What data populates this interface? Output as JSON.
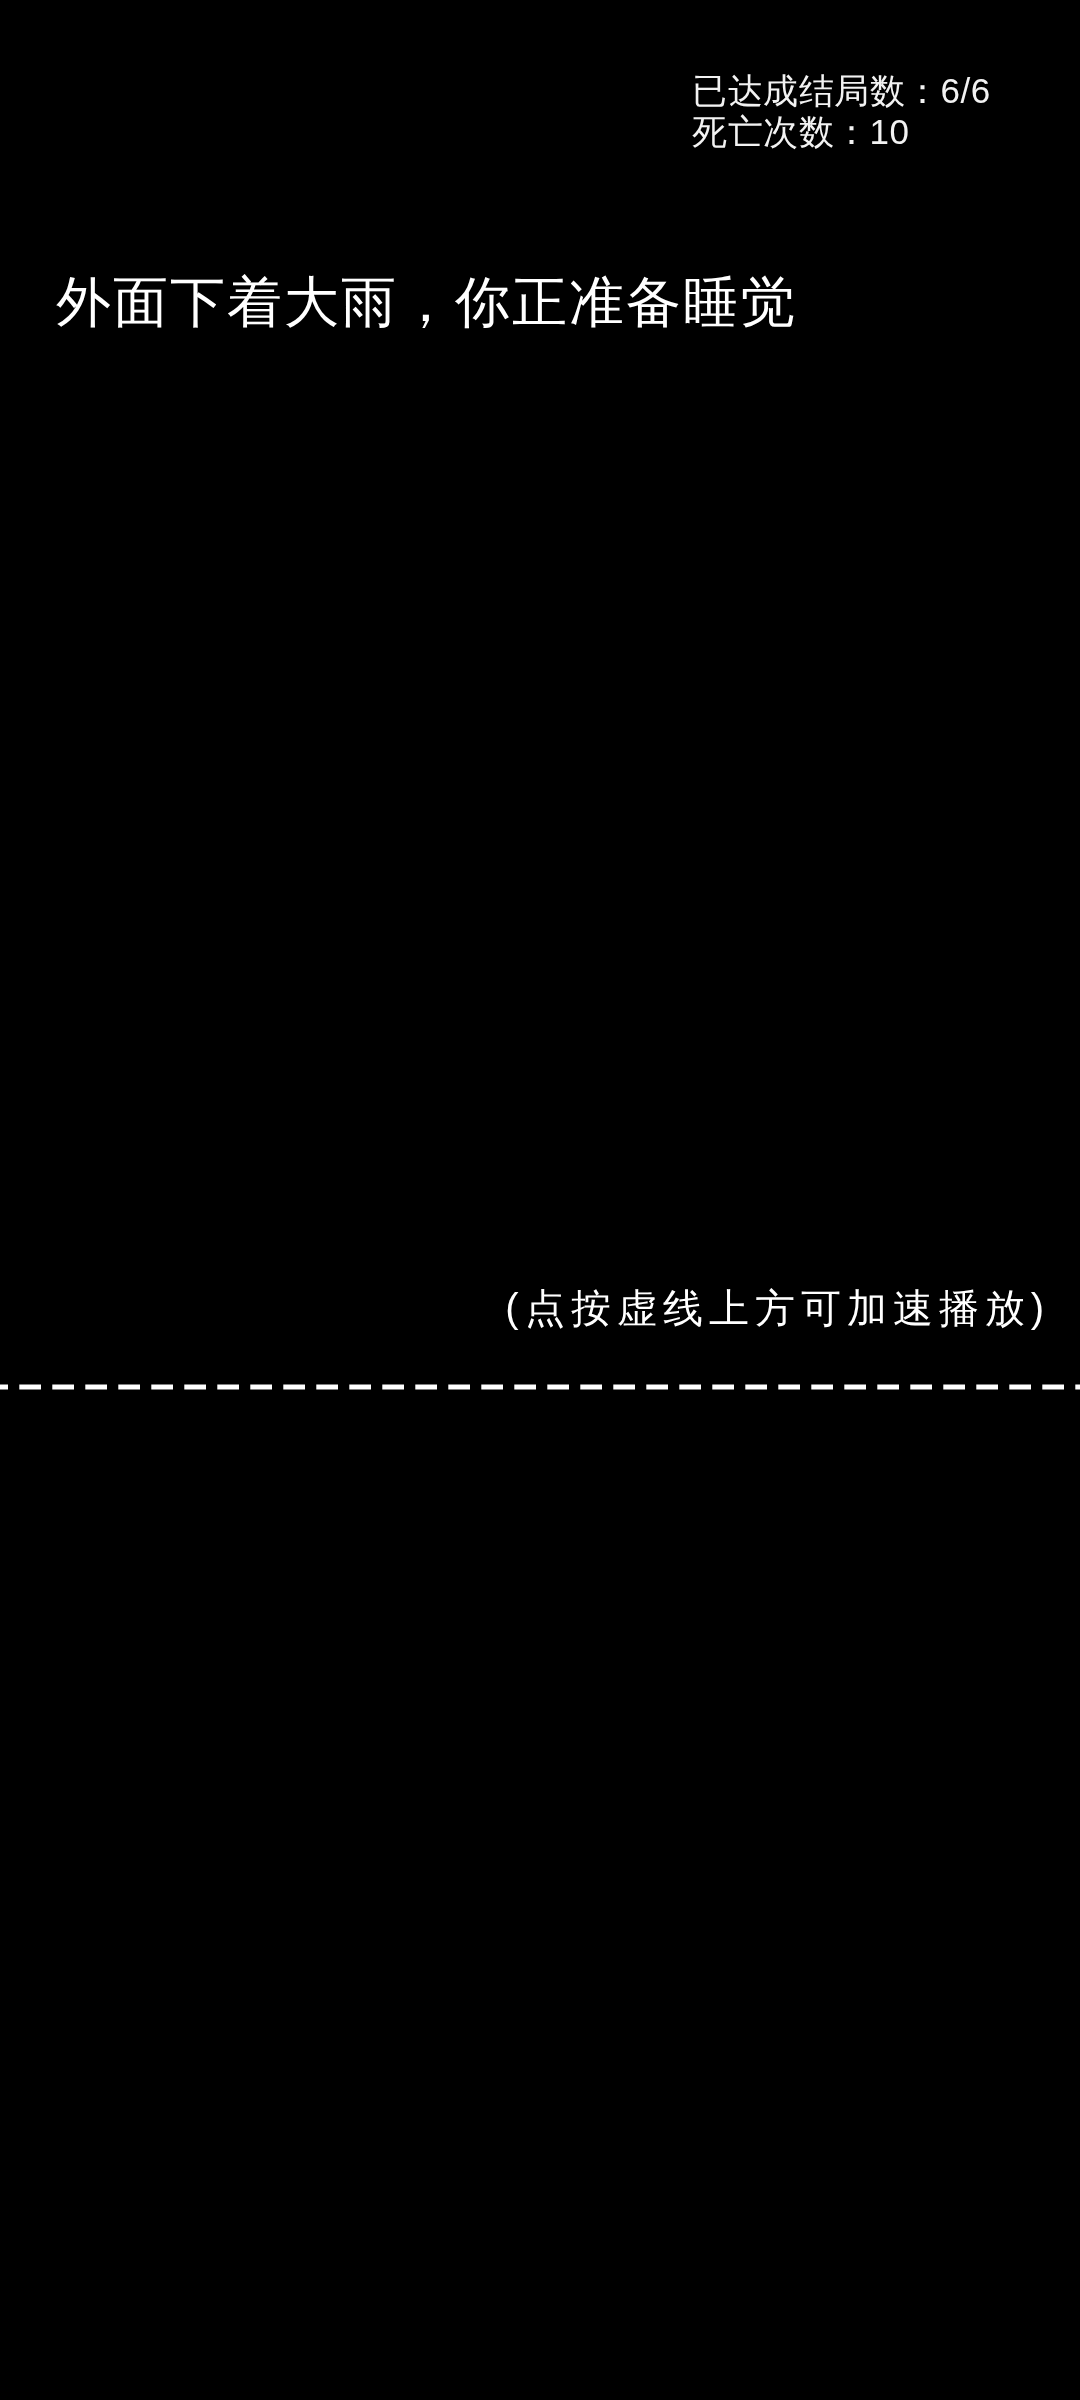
{
  "hud": {
    "endings_reached": "已达成结局数：6/6",
    "deaths": "死亡次数：10"
  },
  "story": {
    "text": "外面下着大雨，你正准备睡觉"
  },
  "hint": {
    "text": "(点按虚线上方可加速播放)"
  }
}
